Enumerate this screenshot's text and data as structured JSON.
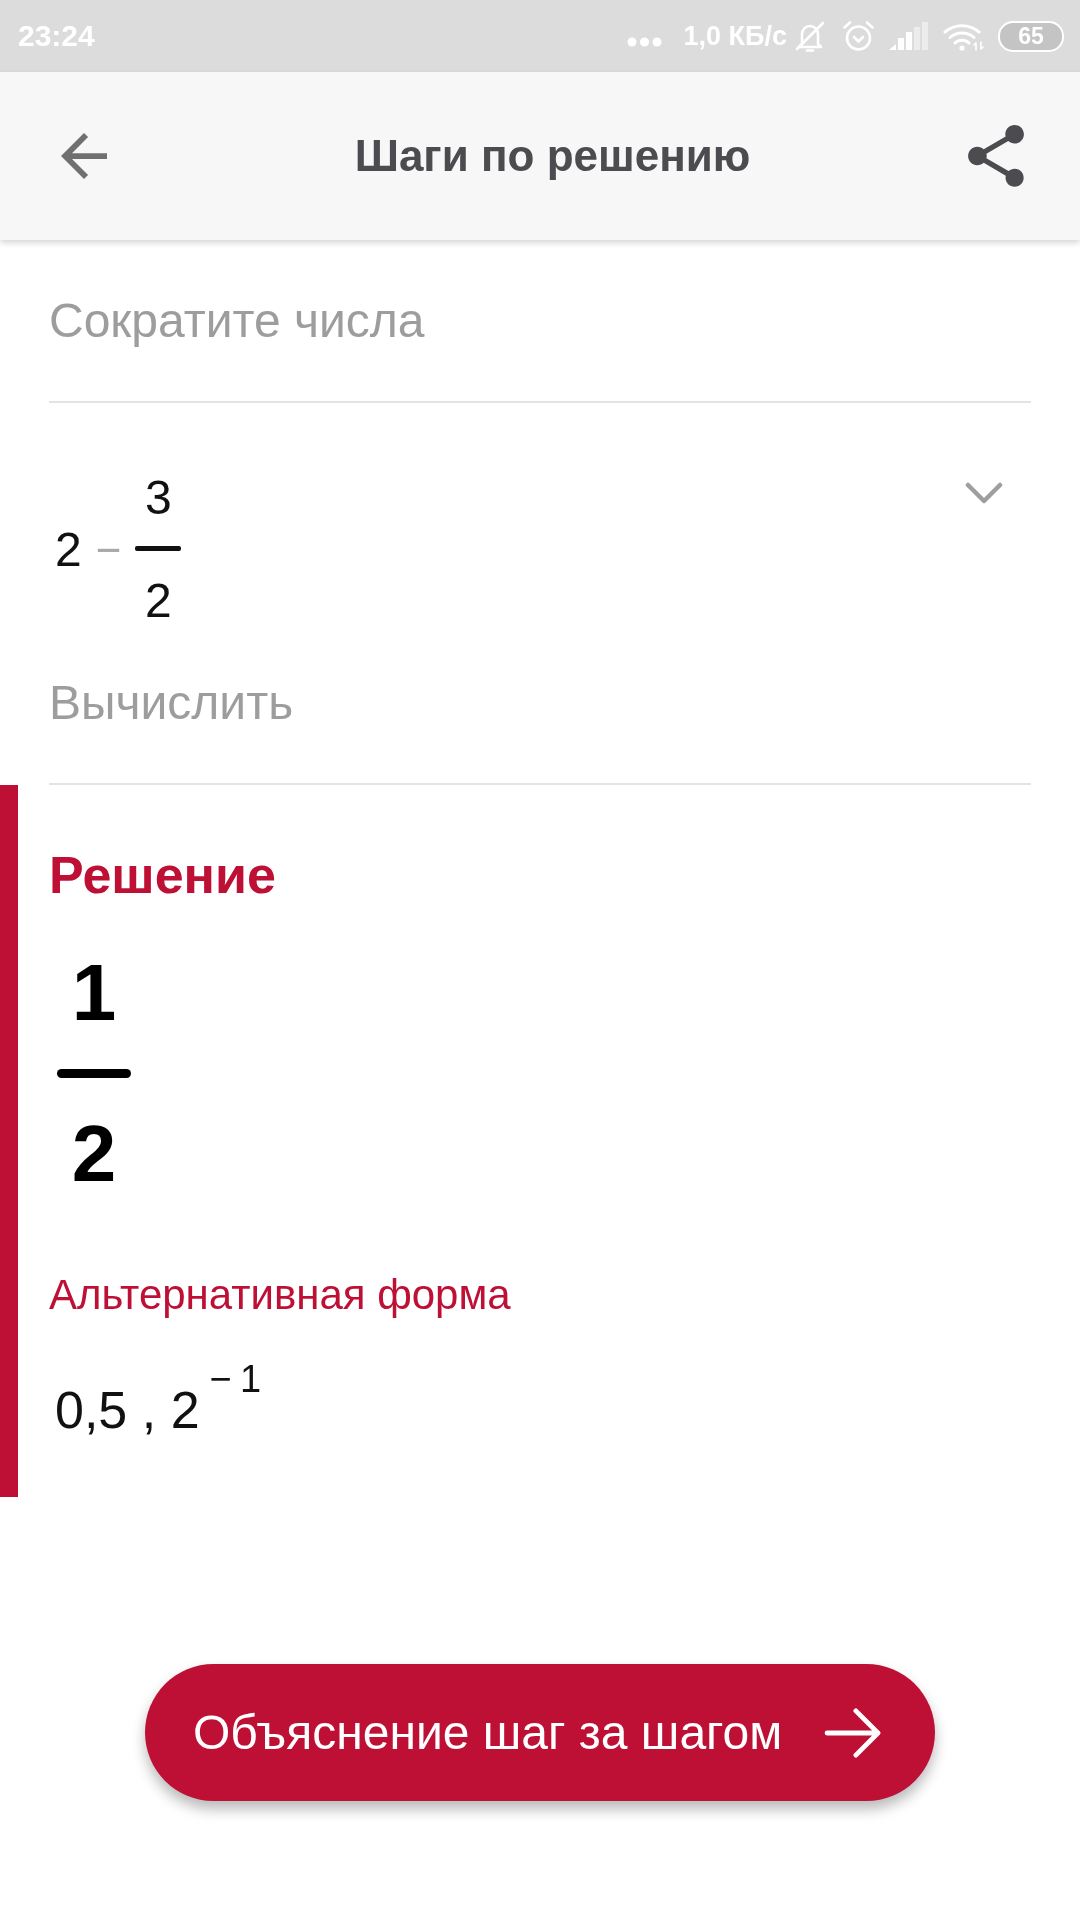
{
  "status_bar": {
    "time": "23:24",
    "network_speed": "1,0 КБ/с",
    "battery": "65"
  },
  "app_bar": {
    "title": "Шаги по решению"
  },
  "steps": [
    {
      "kind": "caption",
      "text": "Сократите числа"
    },
    {
      "kind": "expression",
      "expanded": false,
      "terms": [
        {
          "kind": "number",
          "text": "2"
        },
        {
          "kind": "operator",
          "text": "−"
        },
        {
          "kind": "fraction",
          "numerator": "3",
          "denominator": "2"
        }
      ]
    },
    {
      "kind": "caption",
      "text": "Вычислить"
    }
  ],
  "solution": {
    "title": "Решение",
    "result": {
      "numerator": "1",
      "denominator": "2"
    },
    "alternative_title": "Альтернативная форма",
    "alternative_forms": "0,5 , 2$^{−1}$"
  },
  "action_button": {
    "label": "Объяснение шаг за шагом"
  }
}
